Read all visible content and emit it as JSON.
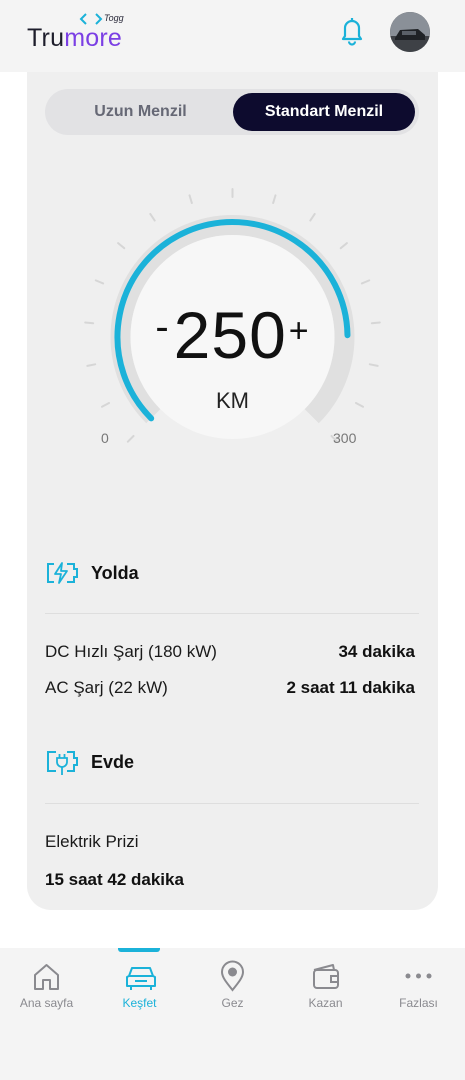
{
  "header": {
    "logo_prefix": "Tru",
    "logo_suffix": "more",
    "logo_brand": "Togg",
    "bell_icon": "bell-icon",
    "avatar_icon": "car-avatar"
  },
  "colors": {
    "accent": "#1bb2d9",
    "dark_navy": "#0d0b2e",
    "logo_purple": "#7b3fe4"
  },
  "range_toggle": {
    "options": [
      "Uzun Menzil",
      "Standart Menzil"
    ],
    "selected": "Standart Menzil"
  },
  "gauge": {
    "minus": "-",
    "value": "250",
    "plus": "+",
    "unit": "KM",
    "min_label": "0",
    "max_label": "300",
    "fill_fraction": 0.83
  },
  "on_road": {
    "title": "Yolda",
    "icon": "fast-charge-battery-icon",
    "rows": [
      {
        "label": "DC Hızlı Şarj (180 kW)",
        "value": "34 dakika"
      },
      {
        "label": "AC Şarj (22 kW)",
        "value": "2 saat 11 dakika"
      }
    ]
  },
  "at_home": {
    "title": "Evde",
    "icon": "plug-battery-icon",
    "label": "Elektrik Prizi",
    "value": "15 saat 42 dakika"
  },
  "tabbar": {
    "items": [
      {
        "label": "Ana sayfa",
        "icon": "home-icon"
      },
      {
        "label": "Keşfet",
        "icon": "car-icon"
      },
      {
        "label": "Gez",
        "icon": "map-pin-icon"
      },
      {
        "label": "Kazan",
        "icon": "wallet-icon"
      },
      {
        "label": "Fazlası",
        "icon": "more-dots-icon"
      }
    ],
    "active": "Keşfet"
  }
}
